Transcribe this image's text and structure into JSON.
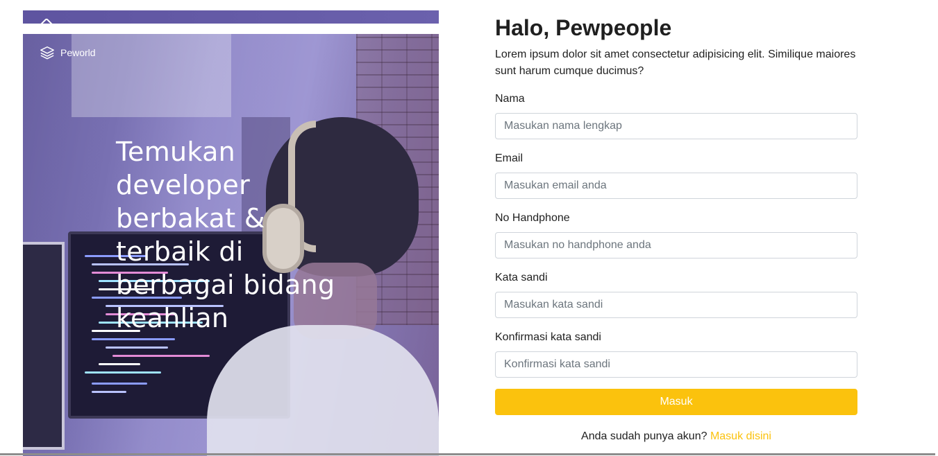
{
  "brand": {
    "name": "Peworld",
    "logo_icon": "layers-icon"
  },
  "hero": {
    "headline": "Temukan developer berbakat & terbaik di berbagai bidang keahlian",
    "overlay_color": "#5e50c8"
  },
  "form": {
    "title": "Halo, Pewpeople",
    "subtitle": "Lorem ipsum dolor sit amet consectetur adipisicing elit. Similique maiores sunt harum cumque ducimus?",
    "fields": [
      {
        "label": "Nama",
        "placeholder": "Masukan nama lengkap",
        "type": "text"
      },
      {
        "label": "Email",
        "placeholder": "Masukan email anda",
        "type": "email"
      },
      {
        "label": "No Handphone",
        "placeholder": "Masukan no handphone anda",
        "type": "tel"
      },
      {
        "label": "Kata sandi",
        "placeholder": "Masukan kata sandi",
        "type": "password"
      },
      {
        "label": "Konfirmasi kata sandi",
        "placeholder": "Konfirmasi kata sandi",
        "type": "password"
      }
    ],
    "submit_label": "Masuk",
    "login_prompt": "Anda sudah punya akun?",
    "login_link": "Masuk disini"
  },
  "colors": {
    "accent": "#fbc20d",
    "text": "#1f1f1f",
    "input_border": "#cfd4da"
  }
}
